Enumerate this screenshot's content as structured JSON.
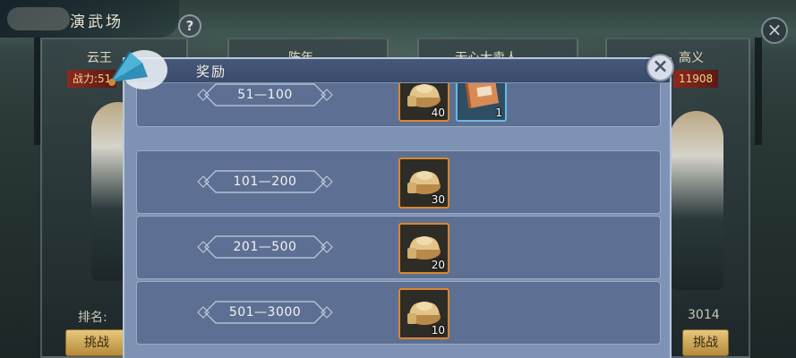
{
  "background": {
    "title": "演武场",
    "help_label": "?",
    "close_label": "×",
    "cards": [
      {
        "name": "云王",
        "power": "战力:51",
        "rank": "排名:",
        "button": "挑战"
      },
      {
        "name": "陈年"
      },
      {
        "name": "无心大卖人"
      },
      {
        "name": "高义",
        "power": "11908",
        "rank": "3014",
        "button": "挑战"
      }
    ]
  },
  "modal": {
    "title": "奖励",
    "close_label": "×",
    "accent": "#d8872e",
    "rows": [
      {
        "range": "51—100",
        "items": [
          {
            "icon": "gold-ingot-icon",
            "count": "40",
            "frame": "gold"
          },
          {
            "icon": "scroll-icon",
            "count": "1",
            "frame": "blue"
          }
        ]
      },
      {
        "range": "101—200",
        "items": [
          {
            "icon": "gold-ingot-icon",
            "count": "30",
            "frame": "gold"
          }
        ]
      },
      {
        "range": "201—500",
        "items": [
          {
            "icon": "gold-ingot-icon",
            "count": "20",
            "frame": "gold"
          }
        ]
      },
      {
        "range": "501—3000",
        "items": [
          {
            "icon": "gold-ingot-icon",
            "count": "10",
            "frame": "gold"
          }
        ]
      }
    ]
  }
}
